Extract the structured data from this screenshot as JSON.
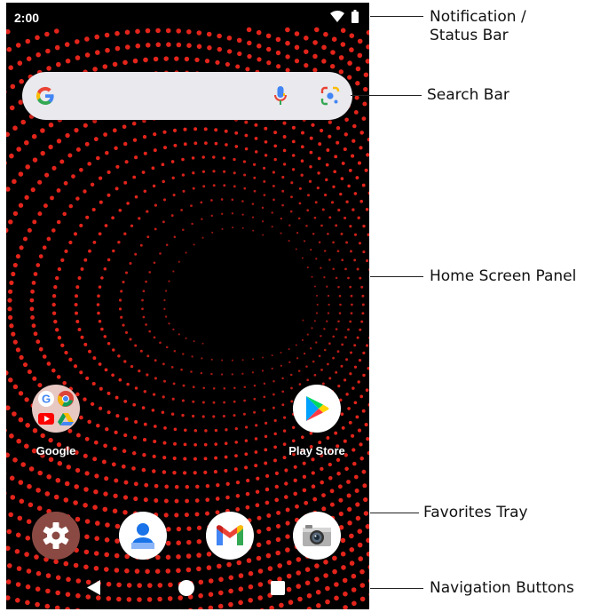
{
  "status_bar": {
    "time": "2:00",
    "icons": [
      "wifi-icon",
      "battery-icon"
    ]
  },
  "search_bar": {
    "logo": "google-g-icon",
    "icons": [
      "microphone-icon",
      "lens-icon"
    ]
  },
  "home_apps": [
    {
      "label": "Google",
      "icon": "google-folder-icon"
    },
    {
      "label": "Play Store",
      "icon": "play-store-icon"
    }
  ],
  "favorites_tray": [
    {
      "icon": "settings-icon"
    },
    {
      "icon": "contacts-icon"
    },
    {
      "icon": "gmail-icon"
    },
    {
      "icon": "camera-icon"
    }
  ],
  "navigation": [
    "back-icon",
    "home-icon",
    "recents-icon"
  ],
  "callouts": [
    {
      "line1": "Notification /",
      "line2": "Status Bar"
    },
    {
      "line1": "Search Bar"
    },
    {
      "line1": "Home Screen Panel"
    },
    {
      "line1": "Favorites Tray"
    },
    {
      "line1": "Navigation Buttons"
    }
  ],
  "colors": {
    "wallpaper": "#000000",
    "dots": "#e3241b",
    "search_bar": "#e9e9ee",
    "settings_bg": "#8a4a43"
  }
}
